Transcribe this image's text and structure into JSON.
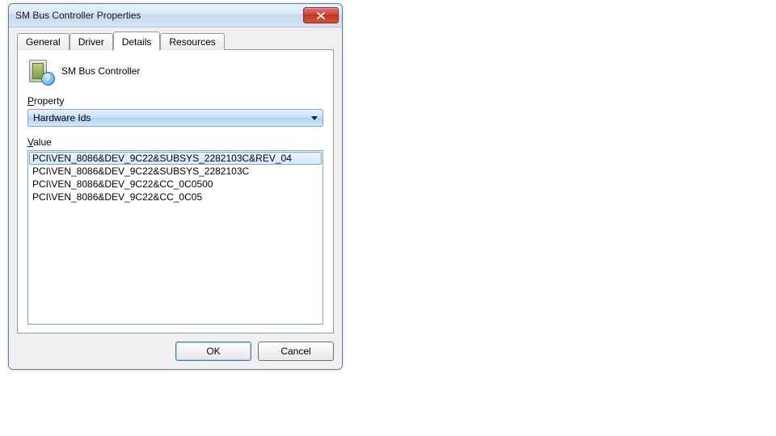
{
  "window": {
    "title": "SM Bus Controller Properties"
  },
  "tabs": {
    "general": "General",
    "driver": "Driver",
    "details": "Details",
    "resources": "Resources"
  },
  "device": {
    "name": "SM Bus Controller"
  },
  "labels": {
    "property_prefix": "P",
    "property_rest": "roperty",
    "value_prefix": "V",
    "value_rest": "alue"
  },
  "property_combo": {
    "selected": "Hardware Ids"
  },
  "values": [
    "PCI\\VEN_8086&DEV_9C22&SUBSYS_2282103C&REV_04",
    "PCI\\VEN_8086&DEV_9C22&SUBSYS_2282103C",
    "PCI\\VEN_8086&DEV_9C22&CC_0C0500",
    "PCI\\VEN_8086&DEV_9C22&CC_0C05"
  ],
  "buttons": {
    "ok": "OK",
    "cancel": "Cancel"
  }
}
